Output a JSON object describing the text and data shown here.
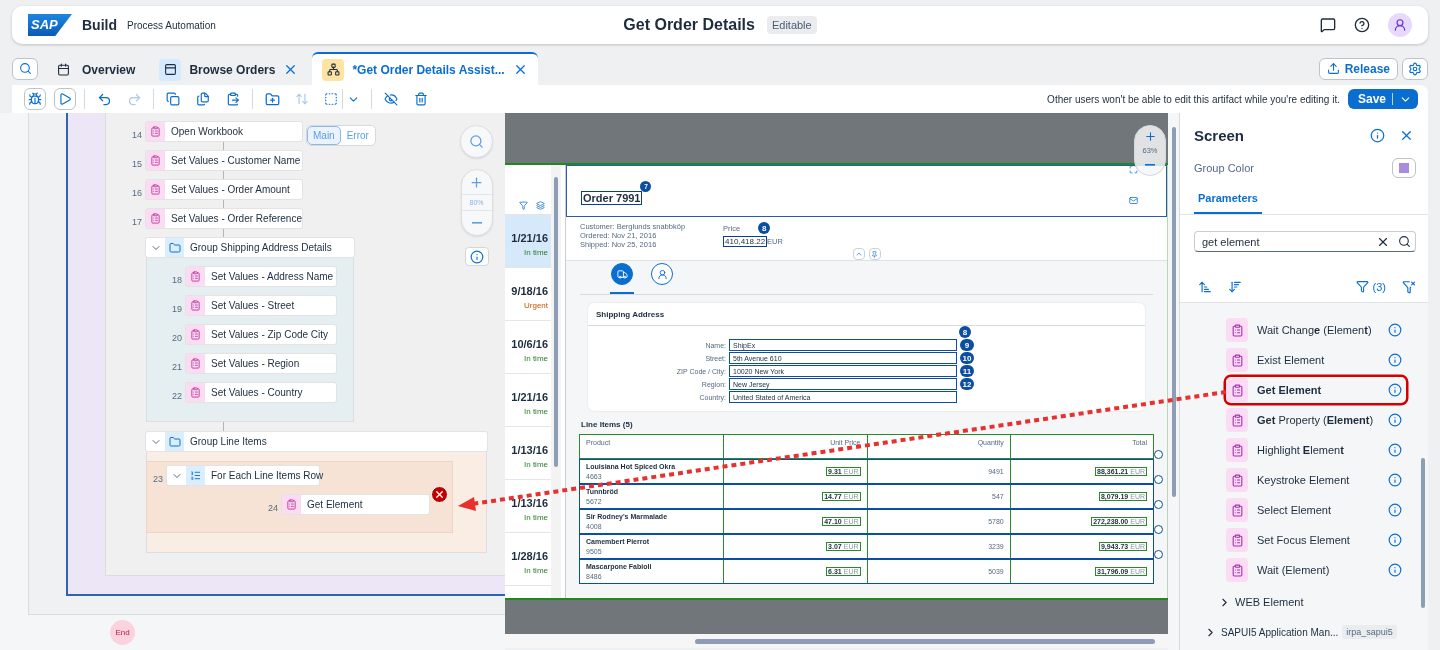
{
  "header": {
    "logo": "SAP",
    "product": "Build",
    "subtitle": "Process Automation",
    "title": "Get Order Details",
    "badge": "Editable"
  },
  "tabs": [
    {
      "kind": "overview",
      "label": "Overview",
      "selected": false,
      "closable": false
    },
    {
      "kind": "screen",
      "label": "Browse Orders",
      "selected": false,
      "closable": true
    },
    {
      "kind": "automation",
      "label": "*Get Order Details Assist...",
      "selected": true,
      "closable": true
    }
  ],
  "release": "Release",
  "toolbar": {
    "tools": [
      {
        "kind": "debug",
        "disabled": false
      },
      {
        "kind": "run",
        "disabled": false
      },
      {
        "kind": "undo",
        "disabled": false
      },
      {
        "kind": "redo",
        "disabled": true
      },
      {
        "kind": "copy",
        "disabled": false
      },
      {
        "kind": "duplicate",
        "disabled": false
      },
      {
        "kind": "paste",
        "disabled": false
      },
      {
        "kind": "add-group",
        "disabled": false
      },
      {
        "kind": "sort",
        "disabled": true
      },
      {
        "kind": "select",
        "disabled": false
      },
      {
        "kind": "hide",
        "disabled": false
      },
      {
        "kind": "delete",
        "disabled": false
      }
    ],
    "message": "Other users won't be able to edit this artifact while you're editing it.",
    "save": "Save"
  },
  "flow": {
    "toggle": [
      {
        "label": "Main",
        "selected": true
      },
      {
        "label": "Error",
        "selected": false
      }
    ],
    "zoom": "80%",
    "end": "End",
    "steps": [
      {
        "kind": "activity",
        "number": "14",
        "label": "Open Workbook",
        "error": false
      },
      {
        "kind": "activity",
        "number": "15",
        "label": "Set Values - Customer Name",
        "error": false
      },
      {
        "kind": "activity",
        "number": "16",
        "label": "Set Values - Order Amount",
        "error": false
      },
      {
        "kind": "activity",
        "number": "17",
        "label": "Set Values - Order Reference",
        "error": false
      },
      {
        "kind": "group",
        "label": "Group Shipping Address Details",
        "expanded": true,
        "color": "#e5eef0",
        "children": [
          {
            "kind": "activity",
            "number": "18",
            "label": "Set Values - Address Name",
            "error": false
          },
          {
            "kind": "activity",
            "number": "19",
            "label": "Set Values - Street",
            "error": false
          },
          {
            "kind": "activity",
            "number": "20",
            "label": "Set Values - Zip Code City",
            "error": false
          },
          {
            "kind": "activity",
            "number": "21",
            "label": "Set Values - Region",
            "error": false
          },
          {
            "kind": "activity",
            "number": "22",
            "label": "Set Values - Country",
            "error": false
          }
        ]
      },
      {
        "kind": "group",
        "label": "Group Line Items",
        "expanded": true,
        "color": "#f9ede4",
        "children": [
          {
            "kind": "loop",
            "number": "23",
            "label": "For Each Line Items Row",
            "expanded": true,
            "children": [
              {
                "kind": "activity",
                "number": "24",
                "label": "Get Element",
                "error": true
              }
            ]
          }
        ]
      }
    ]
  },
  "preview": {
    "zoom": "63%",
    "orders": [
      {
        "date": "1/21/16",
        "status": "In time",
        "kind": "success",
        "selected": true
      },
      {
        "date": "9/18/16",
        "status": "Urgent",
        "kind": "warning",
        "selected": false
      },
      {
        "date": "10/6/16",
        "status": "In time",
        "kind": "success",
        "selected": false
      },
      {
        "date": "1/21/16",
        "status": "In time",
        "kind": "success",
        "selected": false
      },
      {
        "date": "1/13/16",
        "status": "In time",
        "kind": "success",
        "selected": false
      },
      {
        "date": "1/13/16",
        "status": "In time",
        "kind": "success",
        "selected": false
      },
      {
        "date": "1/28/16",
        "status": "In time",
        "kind": "success",
        "selected": false
      }
    ],
    "object": {
      "title": "Order 7991",
      "title_marker": "7",
      "customer": "Customer: Berglunds snabbköp",
      "ordered": "Ordered: Nov 21, 2016",
      "shipped": "Shipped: Nov 25, 2016",
      "price_label": "Price",
      "price": "410,418.22",
      "currency": "EUR",
      "price_marker": "8"
    },
    "icon_tabs": [
      {
        "kind": "truck",
        "selected": true
      },
      {
        "kind": "person",
        "selected": false
      }
    ],
    "address": {
      "title": "Shipping Address",
      "marker": "8",
      "fields": [
        {
          "label": "Name:",
          "value": "ShipEx",
          "marker": "9"
        },
        {
          "label": "Street:",
          "value": "5th Avenue 610",
          "marker": "10"
        },
        {
          "label": "ZIP Code / City:",
          "value": "10020 New York",
          "marker": "11"
        },
        {
          "label": "Region:",
          "value": "New Jersey",
          "marker": "12"
        },
        {
          "label": "Country:",
          "value": "United Stated of America"
        }
      ]
    },
    "line_items": {
      "title": "Line Items (5)",
      "columns": [
        "Product",
        "Unit Price",
        "Quantity",
        "Total"
      ],
      "rows": [
        {
          "product": "Louisiana Hot Spiced Okra",
          "id": "4663",
          "unit_price": "9.31",
          "unit_currency": "EUR",
          "quantity": "9491",
          "total": "88,361.21",
          "total_currency": "EUR"
        },
        {
          "product": "Tunnbröd",
          "id": "5672",
          "unit_price": "14.77",
          "unit_currency": "EUR",
          "quantity": "547",
          "total": "8,079.19",
          "total_currency": "EUR"
        },
        {
          "product": "Sir Rodney's Marmalade",
          "id": "4008",
          "unit_price": "47.10",
          "unit_currency": "EUR",
          "quantity": "5780",
          "total": "272,238.00",
          "total_currency": "EUR"
        },
        {
          "product": "Camembert Pierrot",
          "id": "9505",
          "unit_price": "3.07",
          "unit_currency": "EUR",
          "quantity": "3239",
          "total": "9,943.73",
          "total_currency": "EUR"
        },
        {
          "product": "Mascarpone Fabioli",
          "id": "8486",
          "unit_price": "6.31",
          "unit_currency": "EUR",
          "quantity": "5039",
          "total": "31,796.09",
          "total_currency": "EUR"
        }
      ]
    }
  },
  "panel": {
    "title": "Screen",
    "group_color_label": "Group Color",
    "tabs": [
      {
        "label": "Parameters",
        "selected": true
      }
    ],
    "search": {
      "value": "get element"
    },
    "filter_count": "(3)",
    "items": [
      {
        "label": "Wait Chang**e** (Elemen**t**)",
        "selected": false
      },
      {
        "label": "Exist Element",
        "selected": false
      },
      {
        "label": "Get Element",
        "selected": true
      },
      {
        "label": "**Get** Property (**Element**)",
        "selected": false
      },
      {
        "label": "Highlight **E**lemen**t**",
        "selected": false
      },
      {
        "label": "Keystroke Element",
        "selected": false
      },
      {
        "label": "Select Element",
        "selected": false
      },
      {
        "label": "Set Focus Element",
        "selected": false
      },
      {
        "label": "Wait (Element)",
        "selected": false
      }
    ],
    "tree": [
      {
        "label": "WEB Element",
        "expanded": false
      },
      {
        "label": "SAPUI5 Application Man...",
        "tag": "irpa_sapui5",
        "expanded": false
      }
    ]
  }
}
